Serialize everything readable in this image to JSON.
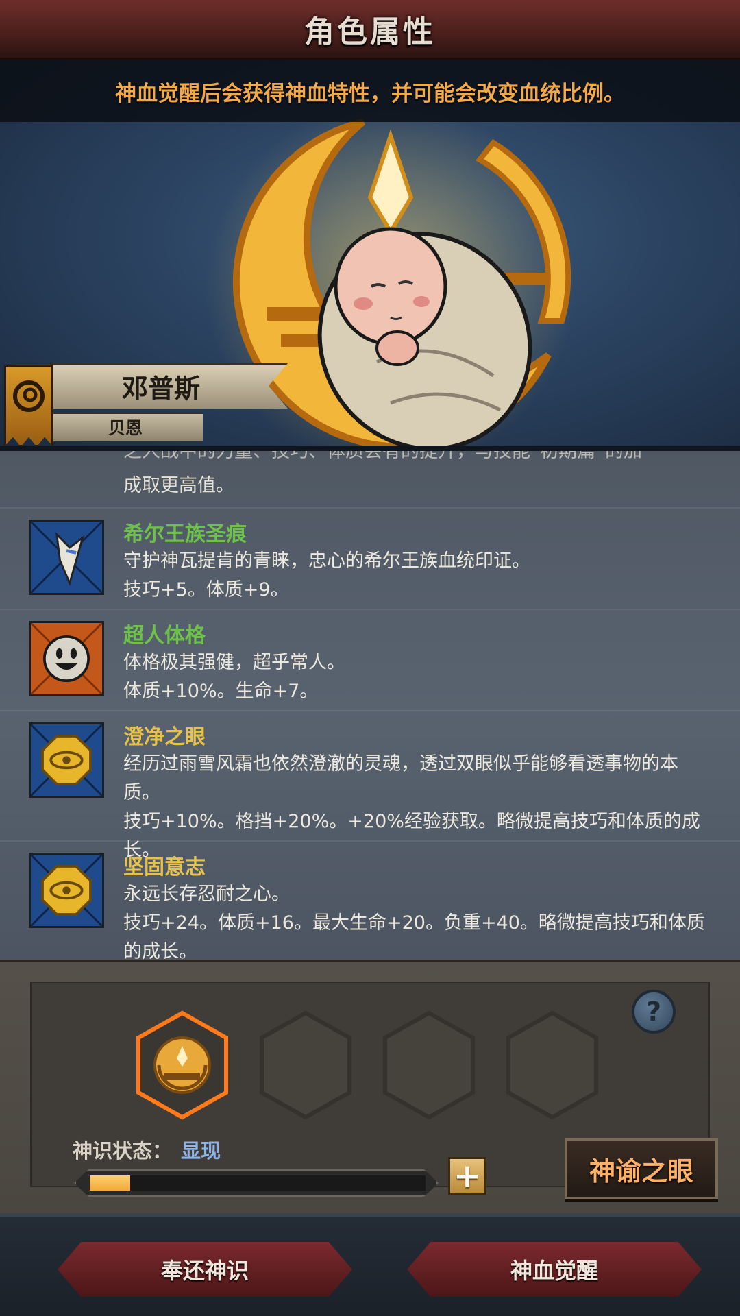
{
  "header": {
    "title": "角色属性"
  },
  "hint": {
    "text": "神血觉醒后会获得神血特性，并可能会改变血统比例。"
  },
  "character": {
    "name": "邓普斯",
    "subname": "贝恩"
  },
  "traits_partial": {
    "line1": "之人战中的力量、技巧、体质会有的提升，与技能“初期篇”的加",
    "line2": "成取更高值。"
  },
  "traits": [
    {
      "name": "希尔王族圣痕",
      "name_color": "green",
      "icon": "claw-icon",
      "line1": "守护神瓦提肯的青睐，忠心的希尔王族血统印证。",
      "line2": "技巧+5。体质+9。",
      "line3": ""
    },
    {
      "name": "超人体格",
      "name_color": "green",
      "icon": "smiley-face-icon",
      "line1": "体格极其强健，超乎常人。",
      "line2": "体质+10%。生命+7。",
      "line3": ""
    },
    {
      "name": "澄净之眼",
      "name_color": "gold",
      "icon": "golden-eye-medal-icon",
      "line1": "经历过雨雪风霜也依然澄澈的灵魂，透过双眼似乎能够看透事物的本质。",
      "line2": "技巧+10%。格挡+20%。+20%经验获取。略微提高技巧和体质的成",
      "line3": "长。"
    },
    {
      "name": "坚固意志",
      "name_color": "gold",
      "icon": "golden-eye-medal-icon",
      "line1": "永远长存忍耐之心。",
      "line2": "技巧+24。体质+16。最大生命+20。负重+40。略微提高技巧和体质",
      "line3": "的成长。"
    }
  ],
  "divine": {
    "status_label": "神识状态：",
    "status_value": "显现",
    "progress": 0.12,
    "plus_label": "+",
    "help_label": "?",
    "oracle_button": "神谕之眼",
    "slots": [
      "active",
      "empty",
      "empty",
      "empty"
    ]
  },
  "footer": {
    "return_button": "奉还神识",
    "awaken_button": "神血觉醒"
  },
  "colors": {
    "green": "#6ec24a",
    "gold": "#e6c24a",
    "hint_orange": "#f2a94a",
    "status_blue": "#8fb4e8",
    "slot_active": "#ff7a1a"
  }
}
